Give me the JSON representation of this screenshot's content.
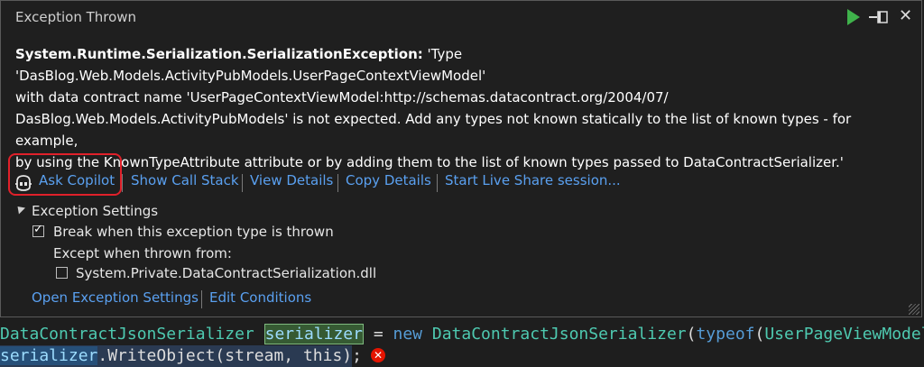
{
  "popup": {
    "title": "Exception Thrown",
    "exception_type": "System.Runtime.Serialization.SerializationException:",
    "message_line1": " 'Type 'DasBlog.Web.Models.ActivityPubModels.UserPageContextViewModel'",
    "message_line2": "with data contract name 'UserPageContextViewModel:http://schemas.datacontract.org/2004/07/",
    "message_line3": "DasBlog.Web.Models.ActivityPubModels' is not expected. Add any types not known statically to the list of known types - for example,",
    "message_line4": "by using the KnownTypeAttribute attribute or by adding them to the list of known types passed to DataContractSerializer.'"
  },
  "actions": {
    "ask_copilot": "Ask Copilot",
    "show_call_stack": "Show Call Stack",
    "view_details": "View Details",
    "copy_details": "Copy Details",
    "live_share": "Start Live Share session..."
  },
  "exception_settings": {
    "header": "Exception Settings",
    "break_when_thrown": "Break when this exception type is thrown",
    "break_checked": true,
    "except_when": "Except when thrown from:",
    "dll_name": "System.Private.DataContractSerialization.dll",
    "dll_checked": false,
    "open_settings": "Open Exception Settings",
    "edit_conditions": "Edit Conditions"
  },
  "code": {
    "l1_type": "DataContractJsonSerializer",
    "l1_var": "serializer",
    "l1_eq": " = ",
    "l1_new": "new",
    "l1_type2": "DataContractJsonSerializer",
    "l1_paren": "(",
    "l1_typeof": "typeof",
    "l1_paren2": "(",
    "l1_model": "UserPageViewModel",
    "l1_close": "))",
    "l2_var": "serializer",
    "l2_rest": ".WriteObject(stream, this);"
  },
  "icons": {
    "continue": "play-icon",
    "pin": "pin-icon",
    "close": "close-icon",
    "copilot": "copilot-icon",
    "error": "error-icon"
  },
  "colors": {
    "link": "#5aa0f0",
    "highlight_box": "#e0202a",
    "play": "#3fb24b",
    "error": "#e51400"
  }
}
